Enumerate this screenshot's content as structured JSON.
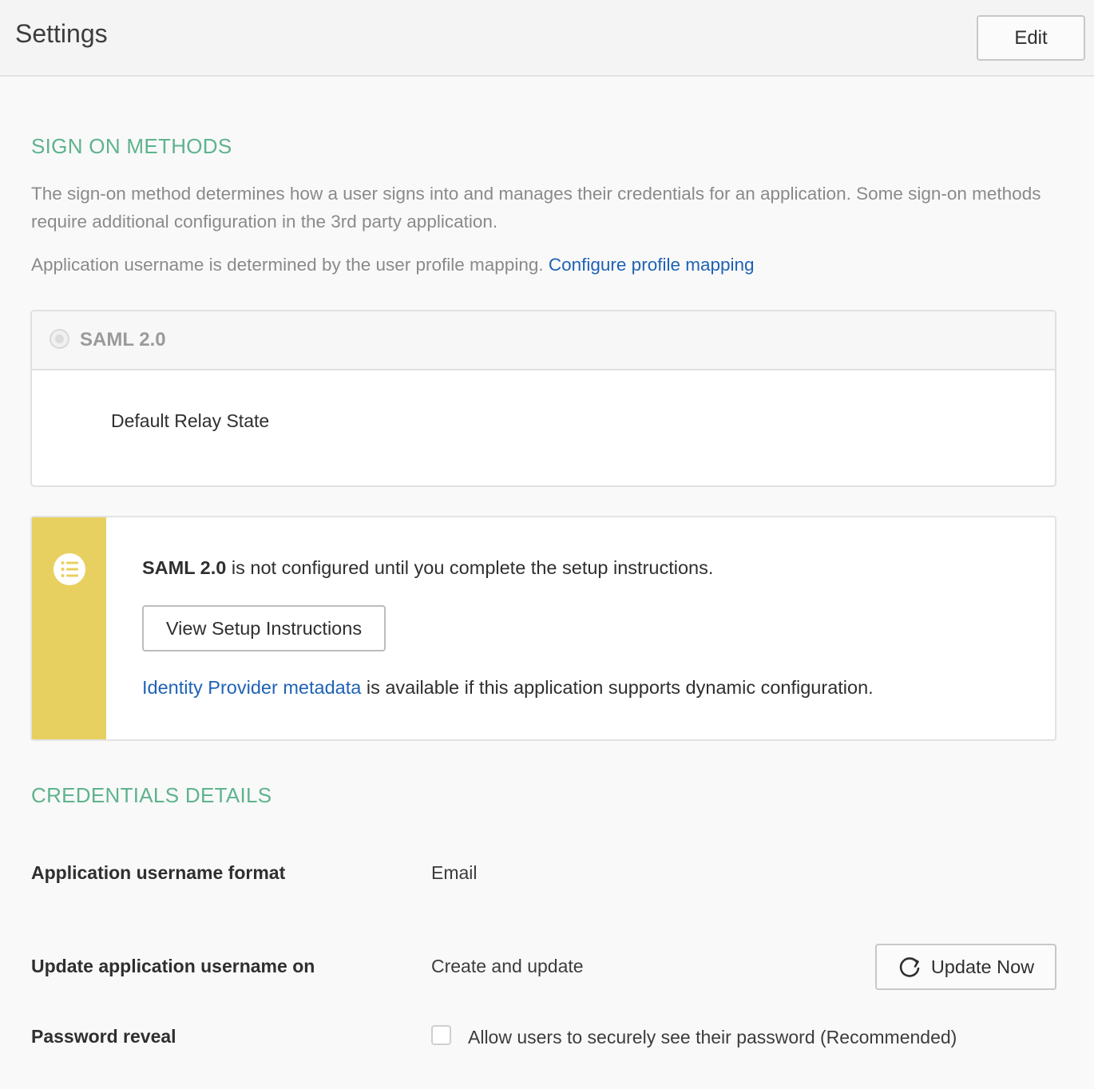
{
  "header": {
    "title": "Settings",
    "edit_label": "Edit"
  },
  "sign_on": {
    "heading": "SIGN ON METHODS",
    "description": "The sign-on method determines how a user signs into and manages their credentials for an application. Some sign-on methods require additional configuration in the 3rd party application.",
    "username_note": "Application username is determined by the user profile mapping.",
    "configure_link": "Configure profile mapping",
    "method_label": "SAML 2.0",
    "relay_state_label": "Default Relay State"
  },
  "notice": {
    "icon": "list-icon",
    "bold_text": "SAML 2.0",
    "message": "is not configured until you complete the setup instructions.",
    "setup_button": "View Setup Instructions",
    "metadata_link": "Identity Provider metadata",
    "metadata_text": "is available if this application supports dynamic configuration."
  },
  "credentials": {
    "heading": "CREDENTIALS DETAILS",
    "rows": [
      {
        "label": "Application username format",
        "value": "Email"
      },
      {
        "label": "Update application username on",
        "value": "Create and update"
      },
      {
        "label": "Password reveal",
        "value": "Allow users to securely see their password (Recommended)"
      }
    ],
    "update_button": "Update Now",
    "password_reveal_checked": false
  },
  "colors": {
    "heading_green": "#5eb38d",
    "link_blue": "#1f62b5",
    "notice_yellow": "#e8d060"
  }
}
